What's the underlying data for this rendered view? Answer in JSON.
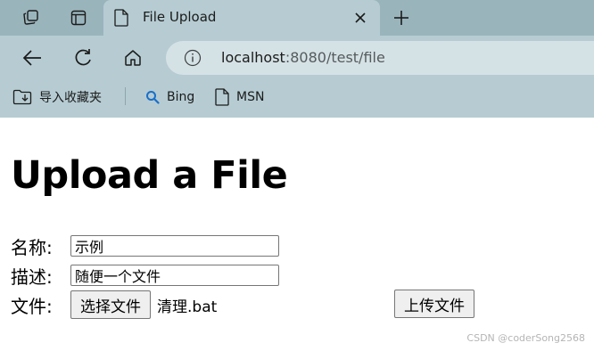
{
  "browser": {
    "tab": {
      "title": "File Upload",
      "close_icon": "close-icon"
    },
    "icons": {
      "workspaces": "workspaces-icon",
      "tab_actions": "tab-actions-icon",
      "new_tab": "plus-icon",
      "back": "back-arrow-icon",
      "reload": "reload-icon",
      "home": "home-icon",
      "info": "info-icon"
    },
    "address": {
      "host": "localhost",
      "rest": ":8080/test/file"
    },
    "favorites": [
      {
        "label": "导入收藏夹",
        "icon": "import-folder-icon"
      },
      {
        "label": "Bing",
        "icon": "search-icon"
      },
      {
        "label": "MSN",
        "icon": "page-icon"
      }
    ]
  },
  "page": {
    "heading": "Upload a File",
    "form": {
      "name_label": "名称:",
      "name_value": "示例",
      "desc_label": "描述:",
      "desc_value": "随便一个文件",
      "file_label": "文件:",
      "choose_button": "选择文件",
      "chosen_file": "清理.bat",
      "submit_button": "上传文件"
    },
    "watermark": "CSDN @coderSong2568"
  },
  "colors": {
    "chrome_bg": "#b6ccd2",
    "tabstrip_bg": "#9ab4bc",
    "address_bg": "#d5e2e5",
    "bing_blue": "#1a6fc9"
  }
}
